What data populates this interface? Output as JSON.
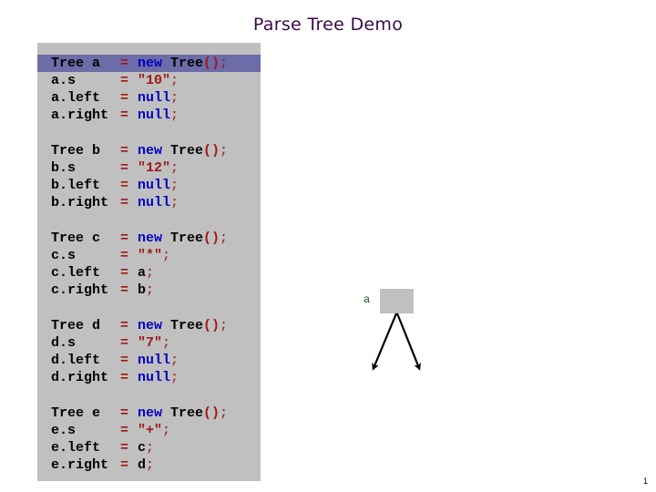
{
  "slide": {
    "title": "Parse Tree Demo",
    "page_number": "1"
  },
  "colors": {
    "title": "#3a0a4a",
    "panel_bg": "#c0c0c0",
    "highlight": "#6c6ca8",
    "keyword": "#0000c0",
    "string": "#a01818",
    "operator": "#a01818",
    "node_label": "#1a5a1a"
  },
  "code": {
    "highlighted_line": 0,
    "blocks": [
      {
        "var": "a",
        "lines": [
          {
            "lhs": "Tree a",
            "eq": "=",
            "rhs_kw": "new",
            "rhs_text": " Tree",
            "rhs_paren": "()",
            "rhs_end": ";"
          },
          {
            "lhs": "a.s",
            "eq": "=",
            "rhs_str": "\"10\"",
            "rhs_end": ";"
          },
          {
            "lhs": "a.left",
            "eq": "=",
            "rhs_kw": "null",
            "rhs_end": ";"
          },
          {
            "lhs": "a.right",
            "eq": "=",
            "rhs_kw": "null",
            "rhs_end": ";"
          }
        ]
      },
      {
        "var": "b",
        "lines": [
          {
            "lhs": "Tree b",
            "eq": "=",
            "rhs_kw": "new",
            "rhs_text": " Tree",
            "rhs_paren": "()",
            "rhs_end": ";"
          },
          {
            "lhs": "b.s",
            "eq": "=",
            "rhs_str": "\"12\"",
            "rhs_end": ";"
          },
          {
            "lhs": "b.left",
            "eq": "=",
            "rhs_kw": "null",
            "rhs_end": ";"
          },
          {
            "lhs": "b.right",
            "eq": "=",
            "rhs_kw": "null",
            "rhs_end": ";"
          }
        ]
      },
      {
        "var": "c",
        "lines": [
          {
            "lhs": "Tree c",
            "eq": "=",
            "rhs_kw": "new",
            "rhs_text": " Tree",
            "rhs_paren": "()",
            "rhs_end": ";"
          },
          {
            "lhs": "c.s",
            "eq": "=",
            "rhs_str": "\"*\"",
            "rhs_end": ";"
          },
          {
            "lhs": "c.left",
            "eq": "=",
            "rhs_plain": "a",
            "rhs_end": ";"
          },
          {
            "lhs": "c.right",
            "eq": "=",
            "rhs_plain": "b",
            "rhs_end": ";"
          }
        ]
      },
      {
        "var": "d",
        "lines": [
          {
            "lhs": "Tree d",
            "eq": "=",
            "rhs_kw": "new",
            "rhs_text": " Tree",
            "rhs_paren": "()",
            "rhs_end": ";"
          },
          {
            "lhs": "d.s",
            "eq": "=",
            "rhs_str": "\"7\"",
            "rhs_end": ";"
          },
          {
            "lhs": "d.left",
            "eq": "=",
            "rhs_kw": "null",
            "rhs_end": ";"
          },
          {
            "lhs": "d.right",
            "eq": "=",
            "rhs_kw": "null",
            "rhs_end": ";"
          }
        ]
      },
      {
        "var": "e",
        "lines": [
          {
            "lhs": "Tree e",
            "eq": "=",
            "rhs_kw": "new",
            "rhs_text": " Tree",
            "rhs_paren": "()",
            "rhs_end": ";"
          },
          {
            "lhs": "e.s",
            "eq": "=",
            "rhs_str": "\"+\"",
            "rhs_end": ";"
          },
          {
            "lhs": "e.left",
            "eq": "=",
            "rhs_plain": "c",
            "rhs_end": ";"
          },
          {
            "lhs": "e.right",
            "eq": "=",
            "rhs_plain": "d",
            "rhs_end": ";"
          }
        ]
      }
    ]
  },
  "diagram": {
    "node_label": "a",
    "node_value": "",
    "children": [
      "left-arrow",
      "right-arrow"
    ]
  }
}
